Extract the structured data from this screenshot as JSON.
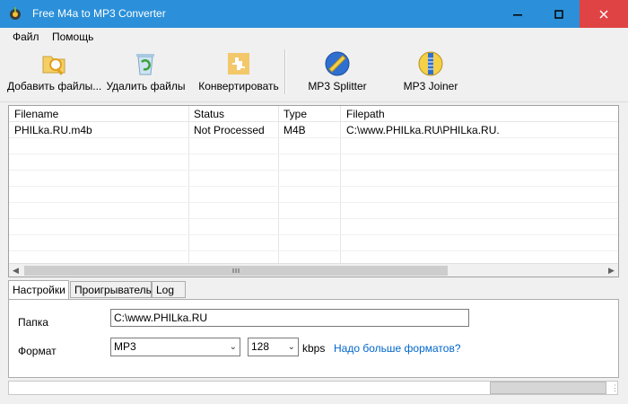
{
  "window": {
    "title": "Free M4a to MP3 Converter"
  },
  "menu": [
    "Файл",
    "Помощь"
  ],
  "toolbar": {
    "add": "Добавить файлы...",
    "remove": "Удалить файлы",
    "convert": "Конвертировать",
    "splitter": "MP3 Splitter",
    "joiner": "MP3 Joiner"
  },
  "table": {
    "columns": [
      "Filename",
      "Status",
      "Type",
      "Filepath"
    ],
    "rows": [
      {
        "filename": "PHILka.RU.m4b",
        "status": "Not Processed",
        "type": "M4B",
        "filepath": "C:\\www.PHILka.RU\\PHILka.RU."
      }
    ]
  },
  "tabs": [
    "Настройки",
    "Проигрыватель",
    "Log"
  ],
  "settings": {
    "folder_label": "Папка",
    "folder_value": "C:\\www.PHILka.RU",
    "format_label": "Формат",
    "format_value": "MP3",
    "bitrate_value": "128",
    "bitrate_unit": "kbps",
    "more_formats_link": "Надо больше форматов?"
  },
  "colors": {
    "titlebar": "#2b90d9",
    "close": "#e04343",
    "link": "#0066cc"
  },
  "icons": [
    "app-icon",
    "minimize-icon",
    "maximize-icon",
    "close-icon",
    "add-files-icon",
    "delete-files-icon",
    "convert-icon",
    "mp3-splitter-icon",
    "mp3-joiner-icon"
  ]
}
